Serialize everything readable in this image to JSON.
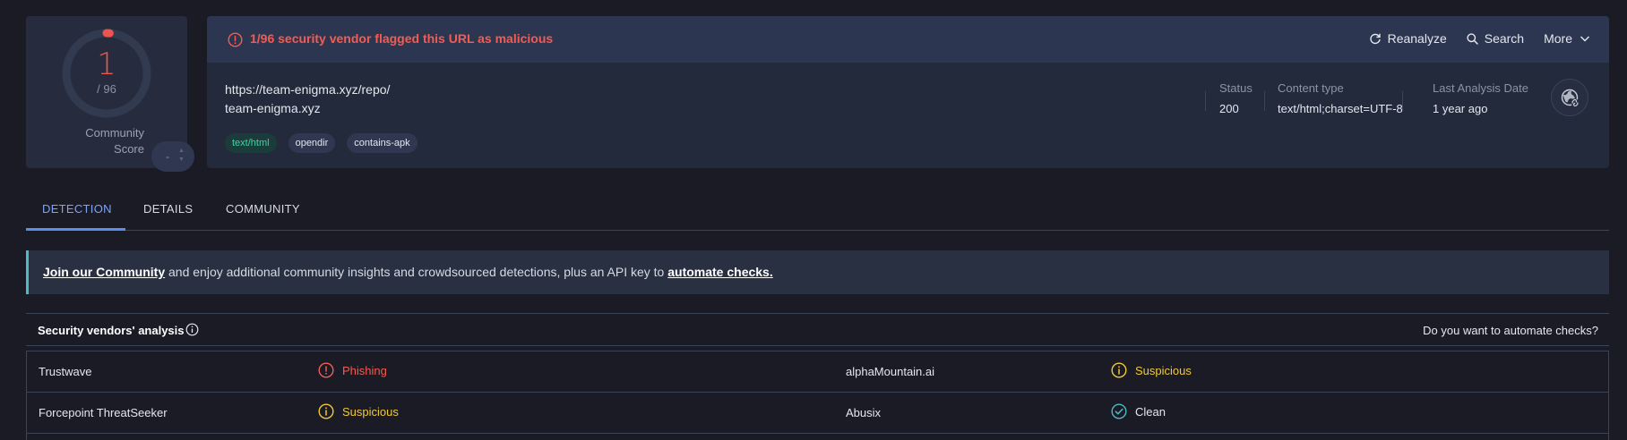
{
  "score": {
    "detected": "1",
    "total": "/ 96",
    "community_label_line1": "Community",
    "community_label_line2": "Score",
    "community_value": "-",
    "ring_fraction": 0.0104,
    "ring_color": "#ef5350"
  },
  "alert": {
    "text": "1/96 security vendor flagged this URL as malicious",
    "icon": "alert-circle-icon"
  },
  "actions": {
    "reanalyze": "Reanalyze",
    "search": "Search",
    "more": "More"
  },
  "target": {
    "url": "https://team-enigma.xyz/repo/",
    "domain": "team-enigma.xyz",
    "tags": [
      "text/html",
      "opendir",
      "contains-apk"
    ]
  },
  "meta": {
    "status_label": "Status",
    "status_value": "200",
    "content_type_label": "Content type",
    "content_type_value": "text/html;charset=UTF-8",
    "last_analysis_label": "Last Analysis Date",
    "last_analysis_value": "1 year ago"
  },
  "tabs": [
    "DETECTION",
    "DETAILS",
    "COMMUNITY"
  ],
  "banner": {
    "link1": "Join our Community",
    "middle": " and enjoy additional community insights and crowdsourced detections, plus an API key to ",
    "link2": "automate checks."
  },
  "vendors": {
    "title": "Security vendors' analysis",
    "automate_prompt": "Do you want to automate checks?",
    "rows": [
      {
        "left_vendor": "Trustwave",
        "left_result": "Phishing",
        "left_status": "malicious",
        "right_vendor": "alphaMountain.ai",
        "right_result": "Suspicious",
        "right_status": "suspicious"
      },
      {
        "left_vendor": "Forcepoint ThreatSeeker",
        "left_result": "Suspicious",
        "left_status": "suspicious",
        "right_vendor": "Abusix",
        "right_result": "Clean",
        "right_status": "clean"
      }
    ]
  },
  "colors": {
    "malicious": "#f25c54",
    "suspicious": "#f0c93a",
    "clean": "#4fb9c4",
    "accent": "#5b8def"
  }
}
